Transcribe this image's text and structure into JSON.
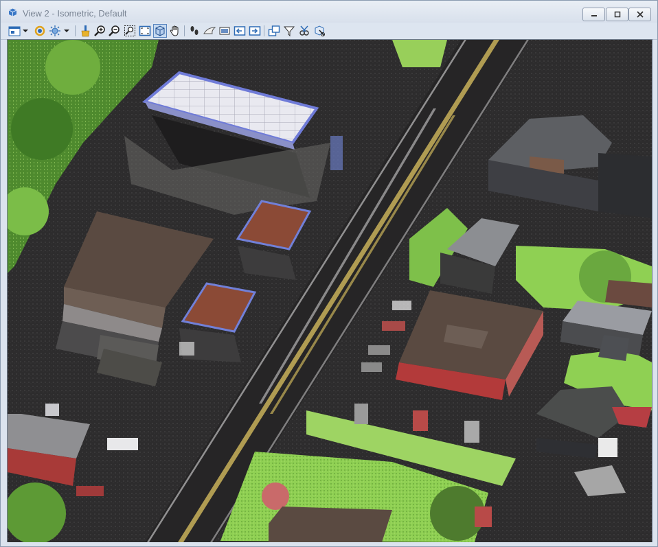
{
  "window": {
    "title": "View 2 - Isometric, Default"
  },
  "toolbar": {
    "tools": [
      {
        "name": "view-attributes-icon"
      },
      {
        "name": "dropdown-arrow-icon"
      },
      {
        "name": "rotate-view-icon"
      },
      {
        "name": "light-source-icon"
      },
      {
        "name": "dropdown-arrow-icon"
      },
      {
        "name": "brush-icon"
      },
      {
        "name": "zoom-in-icon"
      },
      {
        "name": "zoom-out-icon"
      },
      {
        "name": "window-area-icon"
      },
      {
        "name": "fit-view-icon"
      },
      {
        "name": "rotate-3d-cube-icon"
      },
      {
        "name": "pan-hand-icon"
      },
      {
        "name": "walk-footsteps-icon"
      },
      {
        "name": "fly-icon"
      },
      {
        "name": "view-camera-icon"
      },
      {
        "name": "previous-view-icon"
      },
      {
        "name": "next-view-icon"
      },
      {
        "name": "copy-view-icon"
      },
      {
        "name": "clip-volume-icon"
      },
      {
        "name": "clip-mask-icon"
      },
      {
        "name": "clear-clip-icon"
      }
    ]
  },
  "colors": {
    "asphalt": "#2b2a2b",
    "grass": "#7ec04a",
    "roof_brown": "#5a4a41",
    "canopy_white": "#e8e8ef",
    "canopy_border": "#6f7bd8",
    "brick_red": "#b33a3a",
    "lane_yellow": "#c9b25a"
  }
}
